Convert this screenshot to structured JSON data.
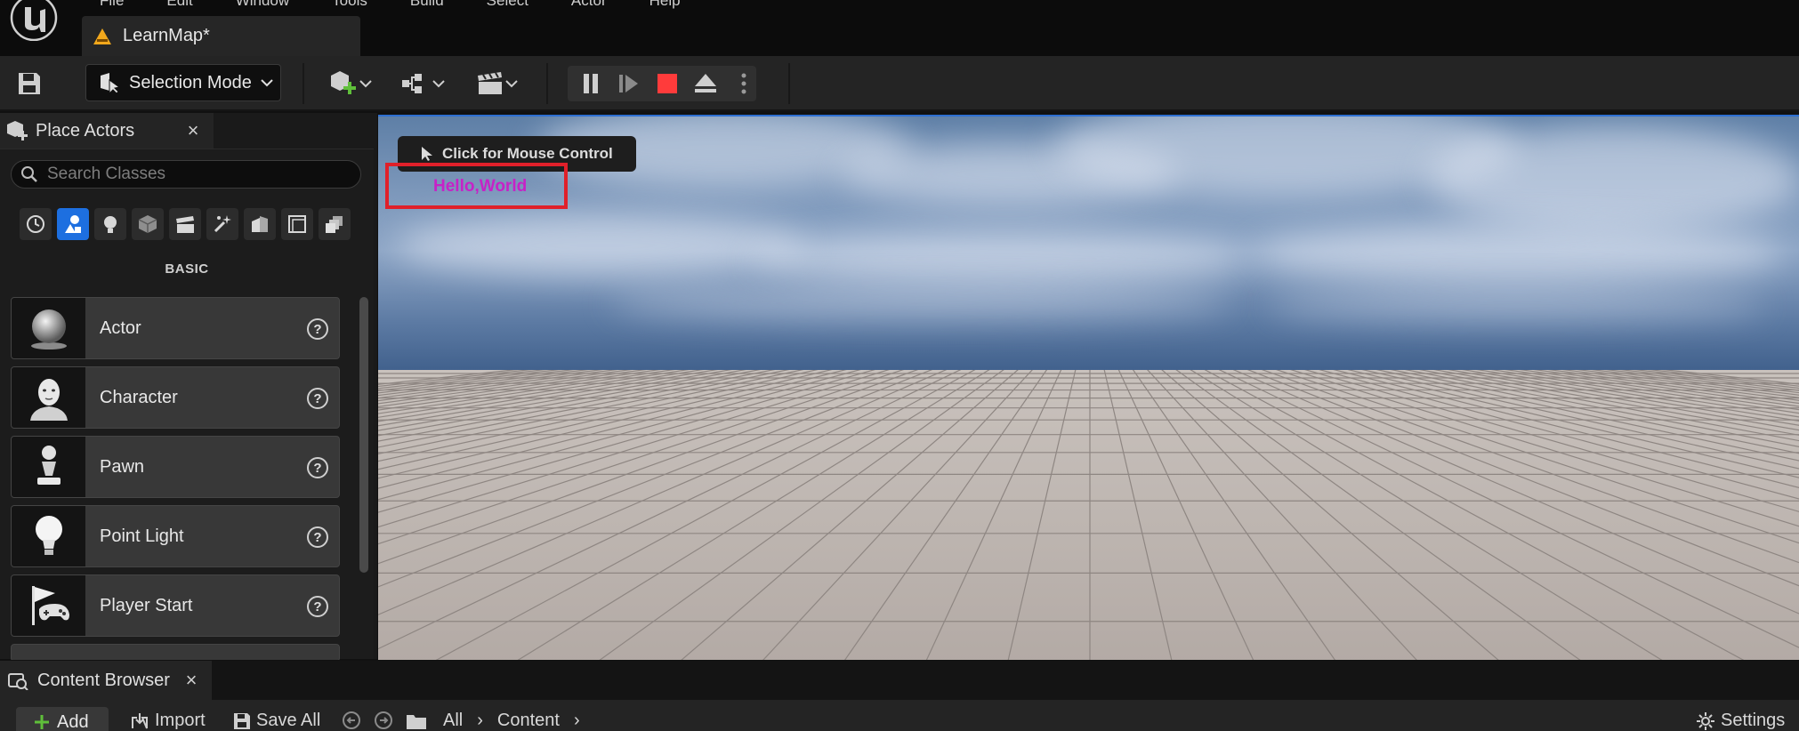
{
  "menu": {
    "items": [
      "File",
      "Edit",
      "Window",
      "Tools",
      "Build",
      "Select",
      "Actor",
      "Help"
    ]
  },
  "document_tab": {
    "title": "LearnMap*"
  },
  "toolbar": {
    "mode_label": "Selection Mode"
  },
  "place_actors": {
    "title": "Place Actors",
    "search_placeholder": "Search Classes",
    "category_label": "BASIC",
    "categories": [
      "recently-placed",
      "basic",
      "lights",
      "shapes",
      "cinematic",
      "visual-effects",
      "geometry",
      "volumes",
      "all-classes"
    ],
    "items": [
      {
        "label": "Actor"
      },
      {
        "label": "Character"
      },
      {
        "label": "Pawn"
      },
      {
        "label": "Point Light"
      },
      {
        "label": "Player Start"
      }
    ]
  },
  "viewport": {
    "mouse_control_label": "Click for Mouse Control",
    "debug_text": "Hello,World",
    "debug_text_color": "#c722c7",
    "highlight_color": "#e0202a"
  },
  "content_browser": {
    "title": "Content Browser",
    "add_label": "Add",
    "import_label": "Import",
    "save_all_label": "Save All",
    "path": [
      "All",
      "Content"
    ],
    "settings_label": "Settings"
  },
  "colors": {
    "accent": "#1d6fe0",
    "stop": "#ff3b3b"
  }
}
